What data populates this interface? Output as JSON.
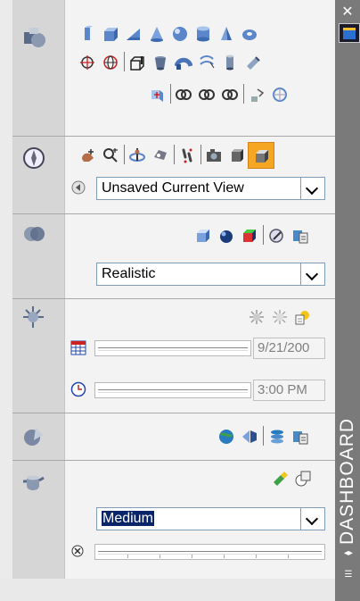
{
  "window": {
    "title": "DASHBOARD",
    "close_icon": "close-icon",
    "colors": {
      "title_bar": "#7a7a7a",
      "highlight": "#0a246a",
      "accent_orange": "#f5a623"
    }
  },
  "panels": {
    "modeling": {
      "icon": "3d-make-icon"
    },
    "navigation": {
      "icon": "3d-navigate-icon",
      "view_dropdown": {
        "selected": "Unsaved Current View"
      }
    },
    "visual_styles": {
      "icon": "visual-styles-icon",
      "style_dropdown": {
        "selected": "Realistic"
      }
    },
    "lights": {
      "icon": "lights-icon",
      "date_value": "9/21/200",
      "time_value": "3:00 PM"
    },
    "materials": {
      "icon": "materials-icon"
    },
    "render": {
      "icon": "render-teapot-icon",
      "quality_dropdown": {
        "selected": "Medium"
      }
    }
  }
}
